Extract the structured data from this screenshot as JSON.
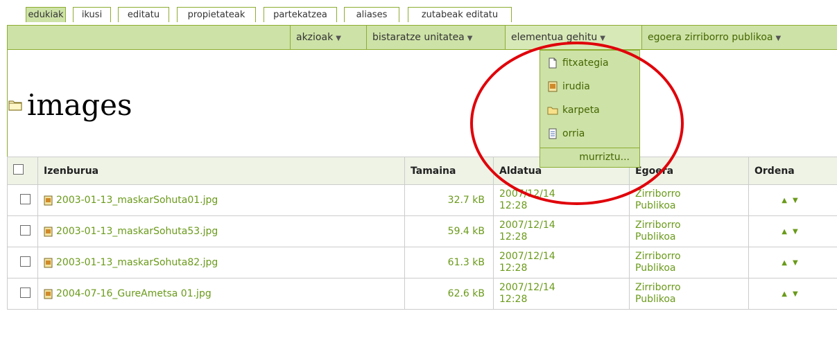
{
  "tabs": [
    {
      "label": "edukiak",
      "active": true
    },
    {
      "label": "ikusi",
      "active": false
    },
    {
      "label": "editatu",
      "active": false
    },
    {
      "label": "propietateak",
      "active": false
    },
    {
      "label": "partekatzea",
      "active": false
    },
    {
      "label": "aliases",
      "active": false
    },
    {
      "label": "zutabeak editatu",
      "active": false
    }
  ],
  "actions": {
    "akzioak": "akzioak",
    "display": "bistaratze unitatea",
    "add": "elementua gehitu",
    "state": "egoera zirriborro publikoa"
  },
  "folder": {
    "title": "images",
    "icon": "folder-icon"
  },
  "add_menu": {
    "items": [
      {
        "label": "fitxategia",
        "icon": "file-icon"
      },
      {
        "label": "irudia",
        "icon": "image-icon"
      },
      {
        "label": "karpeta",
        "icon": "folder-icon"
      },
      {
        "label": "orria",
        "icon": "page-icon"
      }
    ],
    "restrict": "murriztu..."
  },
  "table": {
    "headers": {
      "title": "Izenburua",
      "size": "Tamaina",
      "modified": "Aldatua",
      "state": "Egoera",
      "order": "Ordena"
    },
    "rows": [
      {
        "name": "2003-01-13_maskarSohuta01.jpg",
        "size": "32.7 kB",
        "date_line1": "2007/12/14",
        "date_line2": "12:28",
        "state_line1": "Zirriborro",
        "state_line2": "Publikoa"
      },
      {
        "name": "2003-01-13_maskarSohuta53.jpg",
        "size": "59.4 kB",
        "date_line1": "2007/12/14",
        "date_line2": "12:28",
        "state_line1": "Zirriborro",
        "state_line2": "Publikoa"
      },
      {
        "name": "2003-01-13_maskarSohuta82.jpg",
        "size": "61.3 kB",
        "date_line1": "2007/12/14",
        "date_line2": "12:28",
        "state_line1": "Zirriborro",
        "state_line2": "Publikoa"
      },
      {
        "name": "2004-07-16_GureAmetsa 01.jpg",
        "size": "62.6 kB",
        "date_line1": "2007/12/14",
        "date_line2": "12:28",
        "state_line1": "Zirriborro",
        "state_line2": "Publikoa"
      }
    ]
  },
  "colors": {
    "accent_green": "#8cac31",
    "bar_background": "#cde2a7",
    "link_green": "#6a9a1a",
    "annotation_red": "#e0000a"
  }
}
